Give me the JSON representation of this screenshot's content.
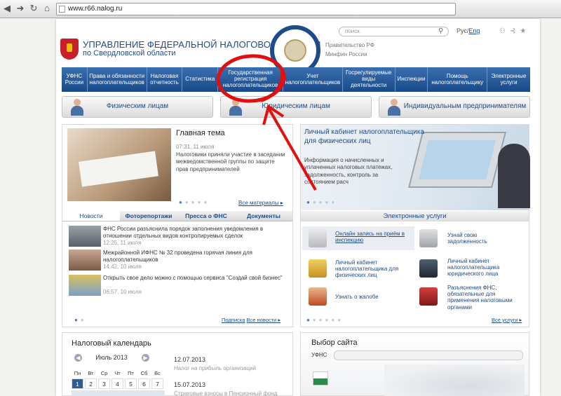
{
  "browser": {
    "url": "www.r66.nalog.ru",
    "back_icon": "back-arrow-icon",
    "forward_icon": "forward-arrow-icon"
  },
  "header": {
    "title_line1": "УПРАВЛЕНИЕ ФЕДЕРАЛЬНОЙ НАЛОГОВОЙ СЛУЖБЫ",
    "title_line2": "по Свердловской области",
    "emblem_text": "ФЕДЕРАЛЬНАЯ НАЛОГОВАЯ СЛУЖБА",
    "search_placeholder": "поиск",
    "lang_ru": "Рус/",
    "lang_en": "Eng",
    "gov_link": "Правительство РФ",
    "minfin_link": "Минфин России"
  },
  "nav": [
    {
      "label": "УФНС России"
    },
    {
      "label": "Права и обязанности налогоплательщиков"
    },
    {
      "label": "Налоговая отчетность"
    },
    {
      "label": "Статистика"
    },
    {
      "label": "Государственная регистрация налогоплательщиков"
    },
    {
      "label": "Учет налогоплательщиков"
    },
    {
      "label": "Госрегулируемые виды деятельности"
    },
    {
      "label": "Инспекции"
    },
    {
      "label": "Помощь налогоплательщику"
    },
    {
      "label": "Электронные услуги"
    }
  ],
  "categories": {
    "individuals": "Физическим лицам",
    "legal": "Юридическим лицам",
    "entrepreneurs": "Индивидуальным предпринимателям"
  },
  "main_news": {
    "title": "Главная тема",
    "time": "07:31, 11 июля",
    "text": "Налоговики приняли участие в заседании межведомственной группы по защите прав предпринимателей",
    "all_materials": "Все материалы ▸"
  },
  "tabs": [
    "Новости",
    "Фоторепортажи",
    "Пресса о ФНС",
    "Документы"
  ],
  "news": [
    {
      "text": "ФНС России разъяснила порядок заполнения уведомления в отношении отдельных видов контролируемых сделок",
      "time": "12:25, 11 июля"
    },
    {
      "text": "Межрайонной ИФНС № 32 проведена горячая линия для налогоплательщиков",
      "time": "14:42, 10 июля"
    },
    {
      "text": "Открыть свое дело можно с помощью сервиса \"Создай свой бизнес\"",
      "time": "06:57, 10 июля"
    }
  ],
  "news_links": {
    "subscribe": "Подписка",
    "all": "Все новости ▸"
  },
  "cabinet": {
    "title": "Личный кабинет налогоплательщика для физических лиц",
    "text": "Информация о начисленных и уплаченных налоговых платежах, задолженность, контроль за состоянием расч"
  },
  "eservices": {
    "heading": "Электронные услуги",
    "items": [
      {
        "label": "Онлайн запись на приём в инспекцию",
        "icon": "pen-tablet-icon"
      },
      {
        "label": "Узнай свою задолженность",
        "icon": "calculator-icon"
      },
      {
        "label": "Личный кабинет налогоплательщика для физических лиц",
        "icon": "cabinet-door-icon"
      },
      {
        "label": "Личный кабинет налогоплательщика юридического лица",
        "icon": "businessman-icon"
      },
      {
        "label": "Узнать о жалобе",
        "icon": "person-icon"
      },
      {
        "label": "Разъяснения ФНС, обязательные для применения налоговыми органами",
        "icon": "documents-icon"
      }
    ],
    "all": "Все услуги ▸"
  },
  "calendar": {
    "title": "Налоговый календарь",
    "month": "Июль 2013",
    "weekdays": [
      "Пн",
      "Вт",
      "Ср",
      "Чт",
      "Пт",
      "Сб",
      "Вс"
    ],
    "week1": [
      "1",
      "2",
      "3",
      "4",
      "5",
      "6",
      "7"
    ],
    "events": [
      {
        "date": "12.07.2013",
        "text": "Налог на прибыль организаций"
      },
      {
        "date": "15.07.2013",
        "text": "Страховые взносы в Пенсионный фонд"
      }
    ]
  },
  "site_select": {
    "title": "Выбор сайта",
    "label": "УФНС"
  },
  "annotation_color": "#e01010",
  "accent": "#1e4b8a"
}
